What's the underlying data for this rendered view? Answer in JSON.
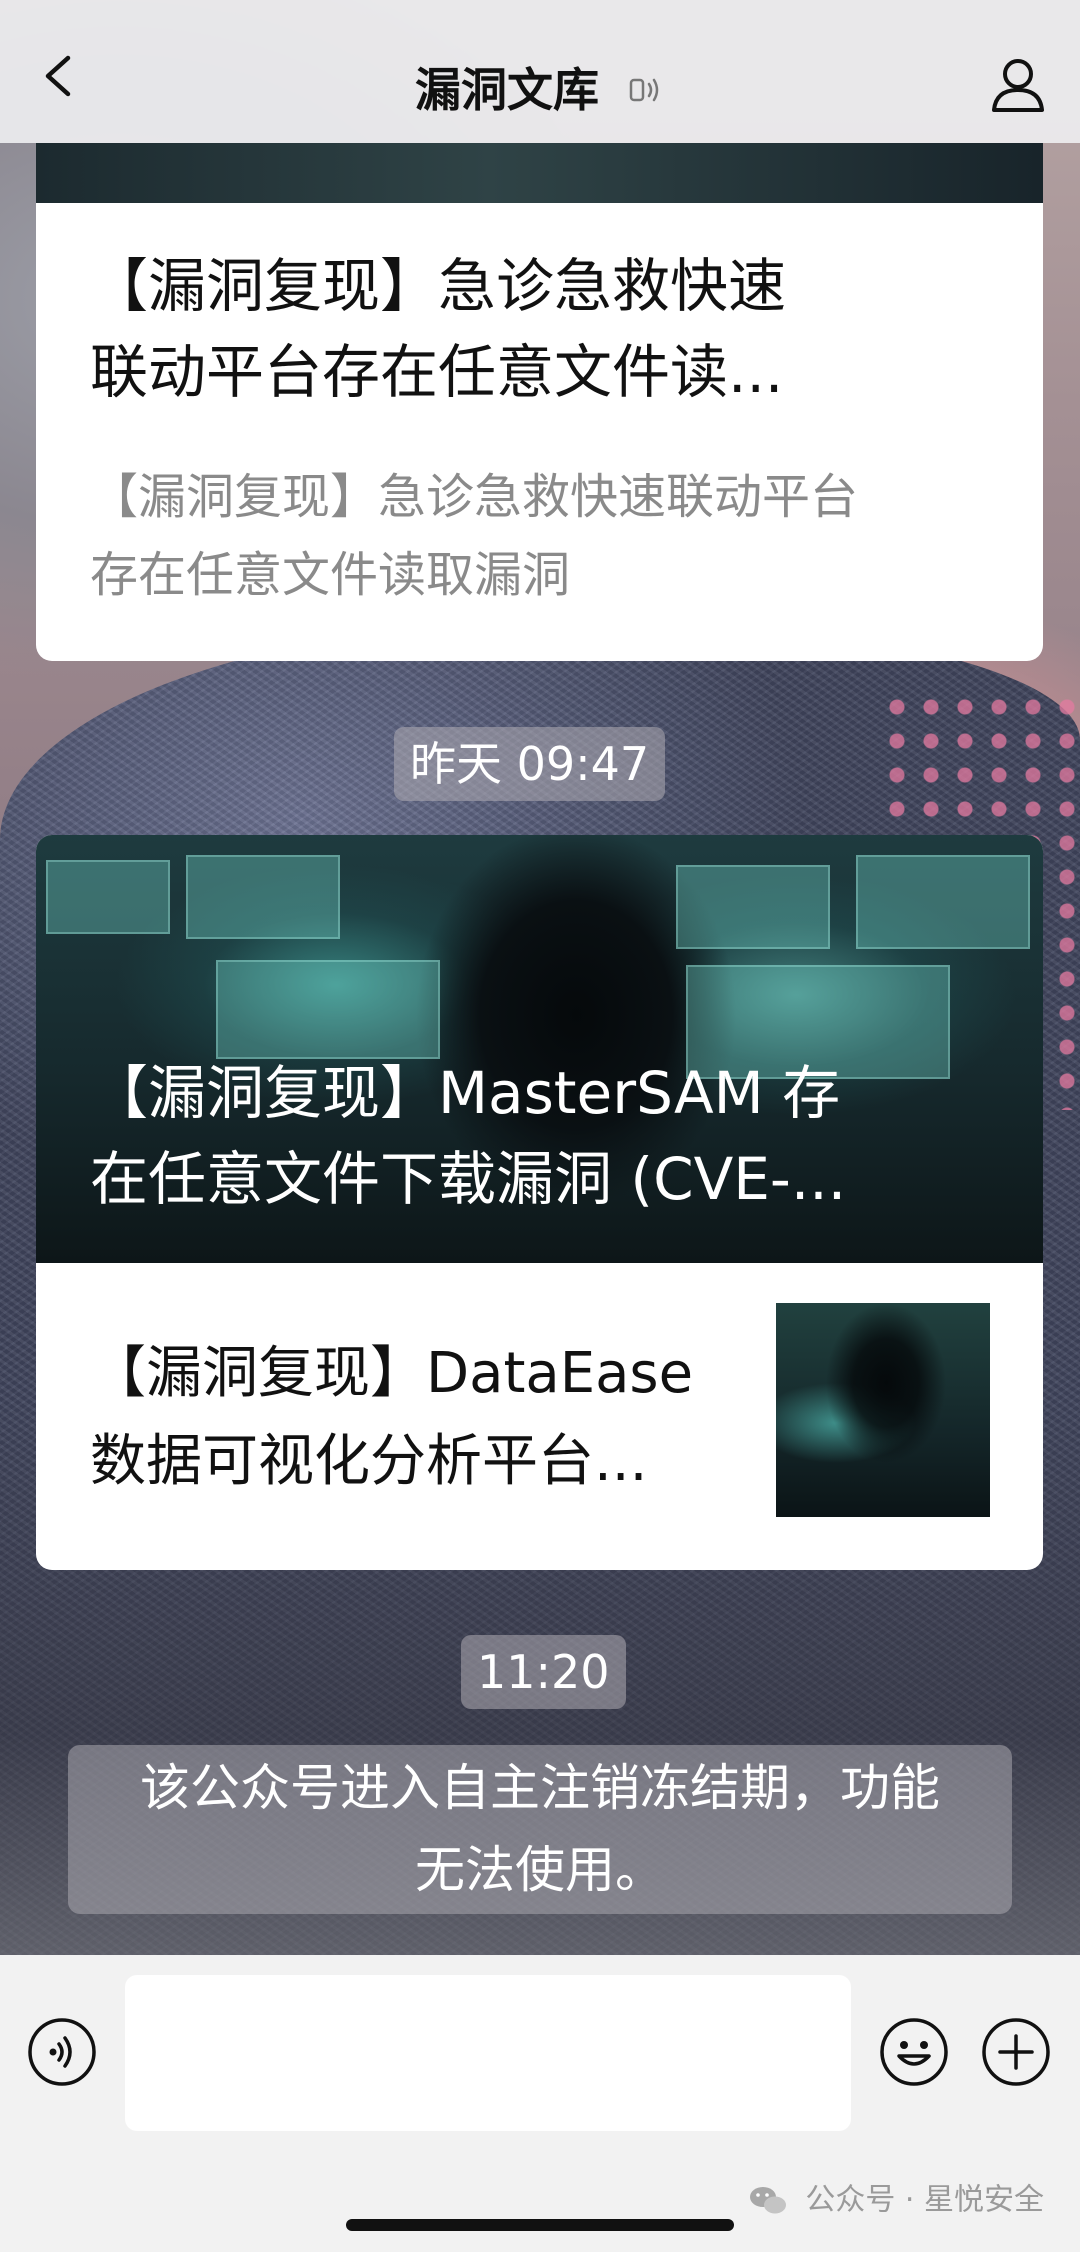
{
  "nav": {
    "title": "漏洞文库"
  },
  "messages": {
    "card1": {
      "title_line1": "【漏洞复现】急诊急救快速",
      "title_line2": "联动平台存在任意文件读...",
      "desc_line1": "【漏洞复现】急诊急救快速联动平台",
      "desc_line2": "存在任意文件读取漏洞"
    },
    "time1": "昨天 09:47",
    "card2": {
      "hero_line1": "【漏洞复现】MasterSAM 存",
      "hero_line2": "在任意文件下载漏洞 (CVE-...",
      "sub_line1": "【漏洞复现】DataEase",
      "sub_line2": "数据可视化分析平台..."
    },
    "time2": "11:20",
    "system_line1": "该公众号进入自主注销冻结期，功能",
    "system_line2": "无法使用。"
  },
  "input": {
    "placeholder": ""
  },
  "watermark": {
    "text": "公众号 · 星悦安全"
  }
}
